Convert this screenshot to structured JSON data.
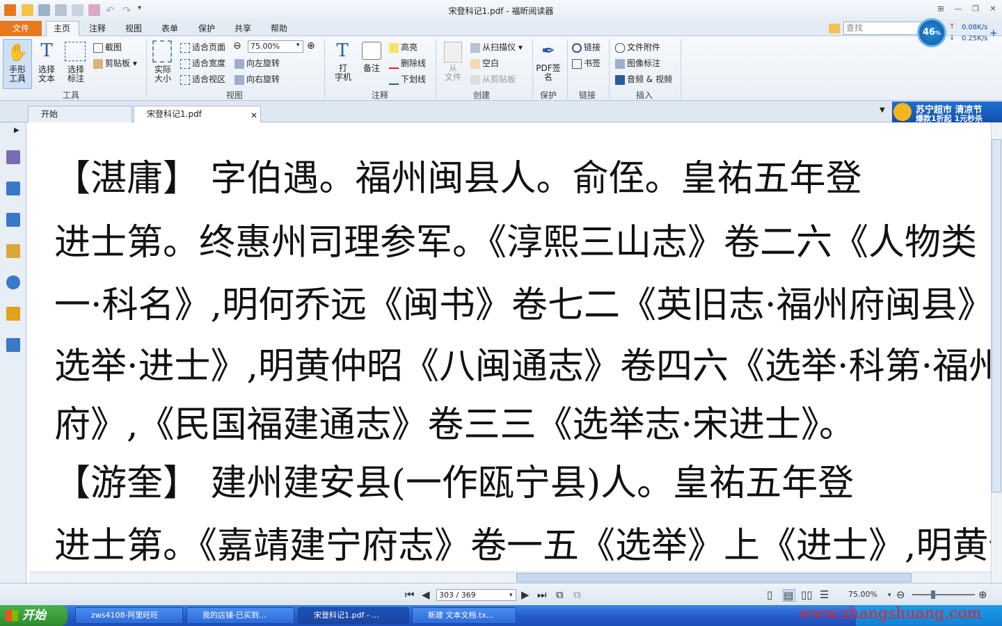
{
  "app": {
    "title": "宋登科记1.pdf - 福昕阅读器"
  },
  "menu": {
    "file": "文件",
    "tabs": [
      "主页",
      "注释",
      "视图",
      "表单",
      "保护",
      "共享",
      "帮助"
    ],
    "search_placeholder": "查找"
  },
  "network": {
    "percent": "46",
    "percent_unit": "%",
    "up": "0.08K/s",
    "down": "0.25K/s"
  },
  "ribbon": {
    "tools": {
      "hand": "手形\n工具",
      "select_text": "选择\n文本",
      "select_annot": "选择\n标注",
      "snapshot": "截图",
      "clipboard": "剪贴板",
      "group": "工具"
    },
    "view": {
      "actual_size": "实际\n大小",
      "fit_page": "适合页面",
      "fit_width": "适合宽度",
      "fit_visible": "适合视区",
      "zoom_value": "75.00%",
      "rotate_left": "向左旋转",
      "rotate_right": "向右旋转",
      "group": "视图"
    },
    "comment": {
      "typewriter": "打\n字机",
      "note": "备注",
      "highlight": "高亮",
      "strikeout": "删除线",
      "underline": "下划线",
      "group": "注释"
    },
    "create": {
      "from_file": "从\n文件",
      "from_scanner": "从扫描仪",
      "blank": "空白",
      "from_clipboard": "从剪贴板",
      "group": "创建"
    },
    "protect": {
      "pdf_sign": "PDF签\n名",
      "group": "保护"
    },
    "links": {
      "link": "链接",
      "bookmark": "书签",
      "group": "链接"
    },
    "insert": {
      "attachment": "文件附件",
      "image": "图像标注",
      "audio_video": "音频 & 视频",
      "group": "插入"
    }
  },
  "doc_tabs": [
    {
      "label": "开始"
    },
    {
      "label": "宋登科记1.pdf"
    }
  ],
  "ad": {
    "line1": "苏宁超市 清凉节",
    "line2": "爆款1折起 1元秒杀"
  },
  "document": {
    "lines": [
      "【湛庸】 字伯遇。福州闽县人。俞侄。皇祐五年登",
      "进士第。终惠州司理参军。《淳熙三山志》卷二六《人物类",
      "一·科名》,明何乔远《闽书》卷七二《英旧志·福州府闽县》上《宋",
      "选举·进士》,明黄仲昭《八闽通志》卷四六《选举·科第·福州",
      "府》,《民国福建通志》卷三三《选举志·宋进士》。",
      "【游奎】 建州建安县(一作瓯宁县)人。皇祐五年登",
      "进士第。《嘉靖建宁府志》卷一五《选举》上《进士》,明黄仲昭《八"
    ]
  },
  "status": {
    "page": "303 / 369",
    "zoom": "75.00%"
  },
  "taskbar": {
    "start": "开始",
    "tasks": [
      {
        "label": "zws4108-阿里旺旺"
      },
      {
        "label": "我的店铺-已买到..."
      },
      {
        "label": "宋登科记1.pdf - ..."
      },
      {
        "label": "新建 文本文档.tx..."
      }
    ]
  },
  "watermark": "www.zhangshuang.com"
}
